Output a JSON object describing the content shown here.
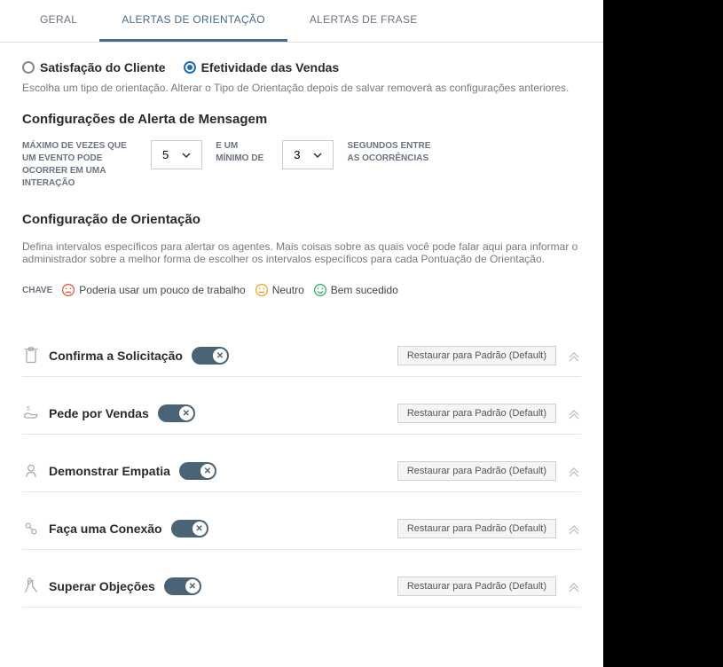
{
  "tabs": {
    "geral": "GERAL",
    "alertas_orientacao": "ALERTAS DE ORIENTAÇÃO",
    "alertas_frase": "ALERTAS DE FRASE"
  },
  "orientation_type": {
    "satisfacao": "Satisfação do Cliente",
    "efetividade": "Efetividade das Vendas",
    "help": "Escolha um tipo de orientação. Alterar o Tipo de Orientação depois de salvar removerá as configurações anteriores."
  },
  "alert_settings": {
    "title": "Configurações de Alerta de Mensagem",
    "max_label": "MÁXIMO DE VEZES QUE UM EVENTO PODE OCORRER EM UMA INTERAÇÃO",
    "max_value": "5",
    "min_label": "E UM MÍNIMO DE",
    "min_value": "3",
    "seconds_label": "SEGUNDOS ENTRE AS OCORRÊNCIAS"
  },
  "guidance_config": {
    "title": "Configuração de Orientação",
    "help": "Defina intervalos específicos para alertar os agentes. Mais coisas sobre as quais você pode falar aqui para informar o administrador sobre a melhor forma de escolher os intervalos específicos para cada Pontuação de Orientação.",
    "key_label": "CHAVE",
    "legend_bad": "Poderia usar um pouco de trabalho",
    "legend_neutral": "Neutro",
    "legend_good": "Bem sucedido"
  },
  "guidance_items": {
    "confirma": "Confirma a Solicitação",
    "pede_vendas": "Pede por Vendas",
    "empatia": "Demonstrar Empatia",
    "conexao": "Faça uma Conexão",
    "objecoes": "Superar Objeções",
    "restore_label": "Restaurar para Padrão (Default)"
  }
}
